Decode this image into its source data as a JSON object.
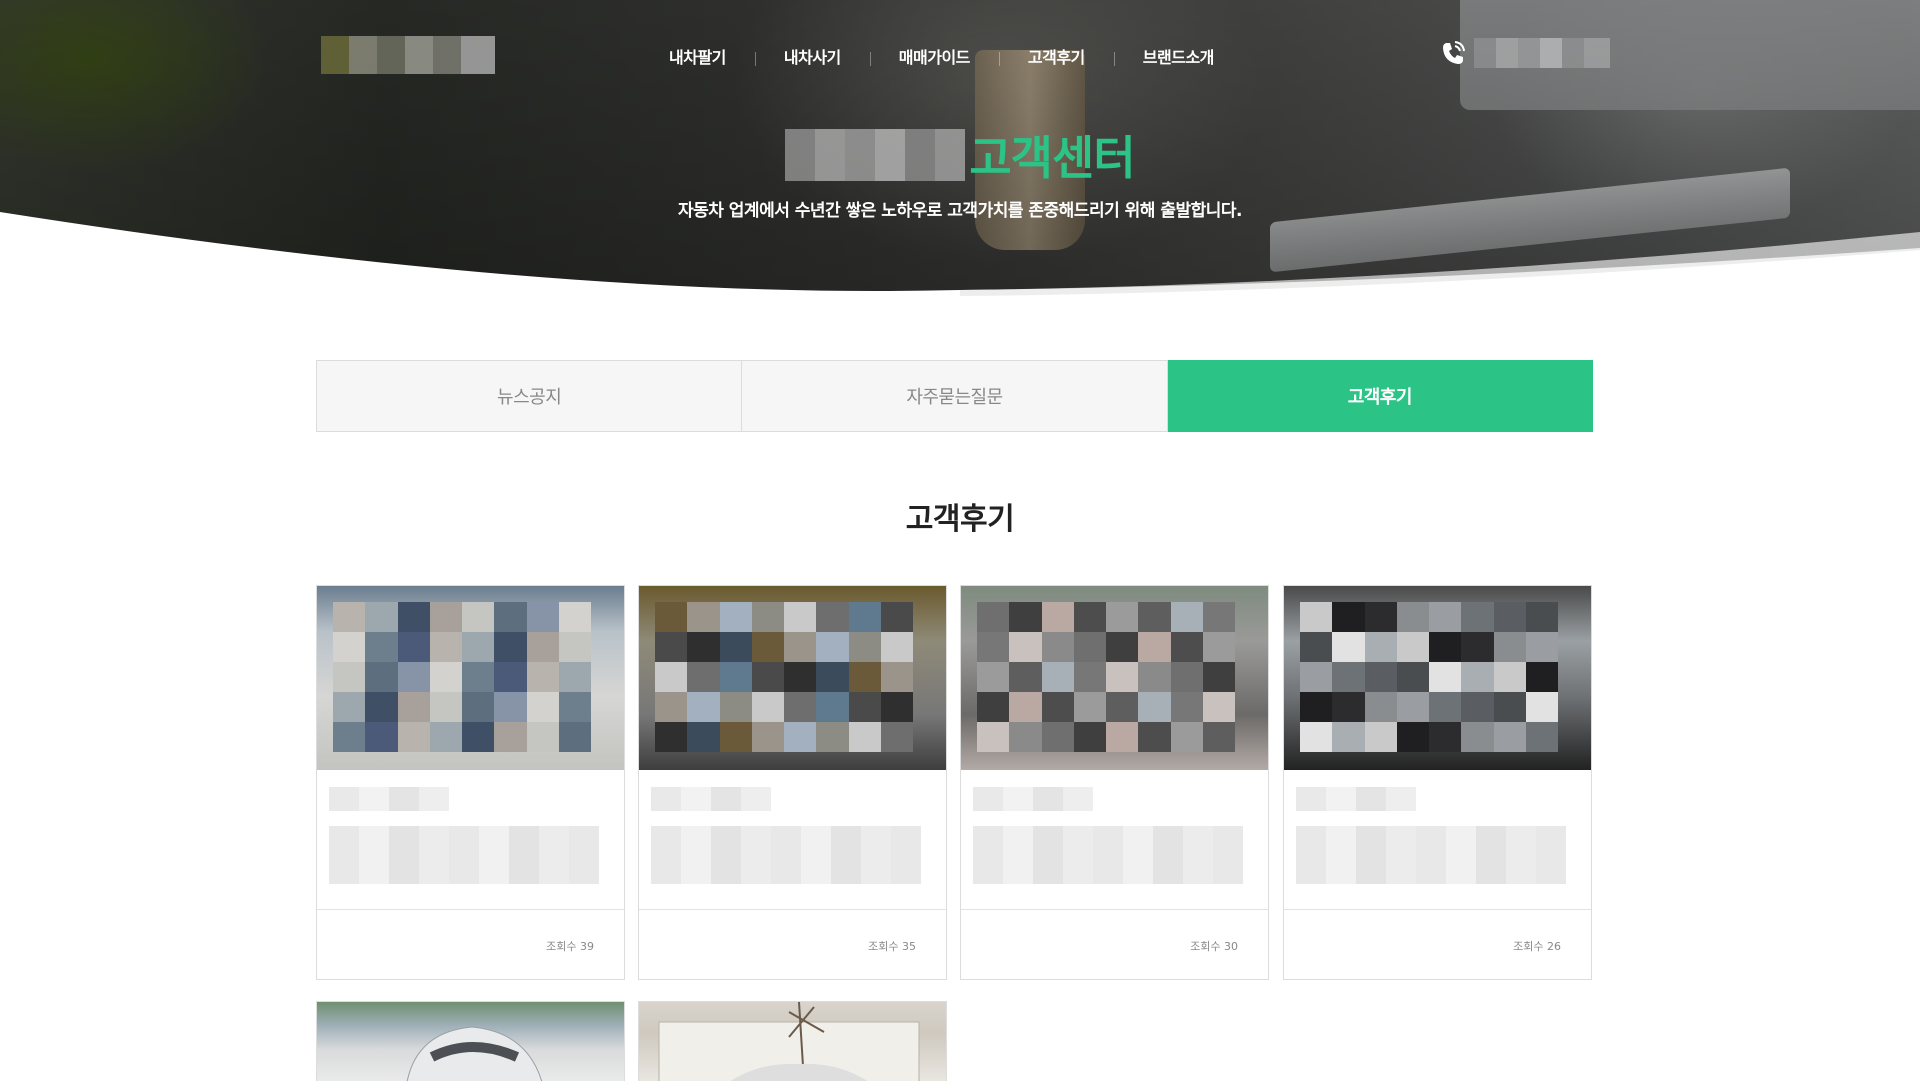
{
  "header": {
    "nav": [
      {
        "label": "내차팔기"
      },
      {
        "label": "내차사기"
      },
      {
        "label": "매매가이드"
      },
      {
        "label": "고객후기"
      },
      {
        "label": "브랜드소개"
      }
    ]
  },
  "hero": {
    "title_highlight": "고객센터",
    "subtitle": "자동차 업계에서 수년간 쌓은 노하우로 고객가치를 존중해드리기 위해 출발합니다."
  },
  "tabs": [
    {
      "label": "뉴스공지",
      "active": false
    },
    {
      "label": "자주묻는질문",
      "active": false
    },
    {
      "label": "고객후기",
      "active": true
    }
  ],
  "section": {
    "title": "고객후기"
  },
  "reviews": [
    {
      "views": "조회수 39"
    },
    {
      "views": "조회수 35"
    },
    {
      "views": "조회수 30"
    },
    {
      "views": "조회수 26"
    }
  ],
  "colors": {
    "accent": "#2bc386",
    "tab_bg": "#f6f6f6",
    "border": "#dcdcdc"
  }
}
